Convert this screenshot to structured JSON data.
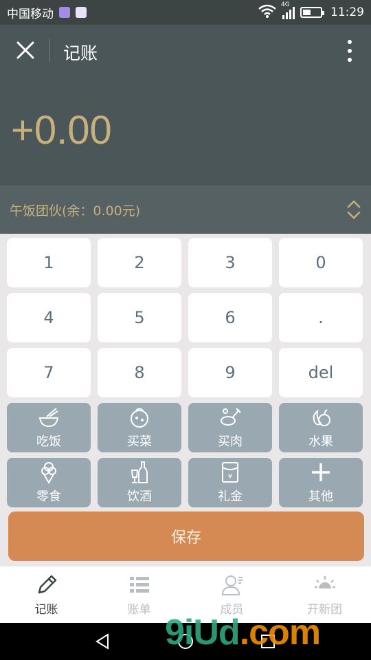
{
  "status_bar": {
    "carrier": "中国移动",
    "network": "4G",
    "time": "11:29",
    "battery_level": 0.45
  },
  "header": {
    "title": "记账",
    "amount": "+0.00"
  },
  "group": {
    "label": "午饭团伙(余：0.00元)"
  },
  "keypad": [
    {
      "label": "1",
      "name": "key-1"
    },
    {
      "label": "2",
      "name": "key-2"
    },
    {
      "label": "3",
      "name": "key-3"
    },
    {
      "label": "0",
      "name": "key-0"
    },
    {
      "label": "4",
      "name": "key-4"
    },
    {
      "label": "5",
      "name": "key-5"
    },
    {
      "label": "6",
      "name": "key-6"
    },
    {
      "label": ".",
      "name": "key-dot"
    },
    {
      "label": "7",
      "name": "key-7"
    },
    {
      "label": "8",
      "name": "key-8"
    },
    {
      "label": "9",
      "name": "key-9"
    },
    {
      "label": "del",
      "name": "key-del"
    }
  ],
  "categories": [
    {
      "label": "吃饭",
      "icon": "bowl-icon"
    },
    {
      "label": "买菜",
      "icon": "vegetable-icon"
    },
    {
      "label": "买肉",
      "icon": "meat-icon"
    },
    {
      "label": "水果",
      "icon": "fruit-icon"
    },
    {
      "label": "零食",
      "icon": "ice-cream-icon"
    },
    {
      "label": "饮酒",
      "icon": "bottle-icon"
    },
    {
      "label": "礼金",
      "icon": "red-envelope-icon"
    },
    {
      "label": "其他",
      "icon": "plus-icon"
    }
  ],
  "save_button": {
    "label": "保存"
  },
  "bottom_nav": [
    {
      "label": "记账",
      "icon": "pencil-icon",
      "active": true
    },
    {
      "label": "账单",
      "icon": "list-icon",
      "active": false
    },
    {
      "label": "成员",
      "icon": "person-icon",
      "active": false
    },
    {
      "label": "开新团",
      "icon": "sun-icon",
      "active": false
    }
  ],
  "watermark": {
    "brand": "9iUd",
    "suffix": ".com"
  },
  "colors": {
    "header_bg": "#4a5657",
    "amount_gold": "#c8b07c",
    "category_bg": "#9aa8b1",
    "save_orange": "#d48a52"
  }
}
